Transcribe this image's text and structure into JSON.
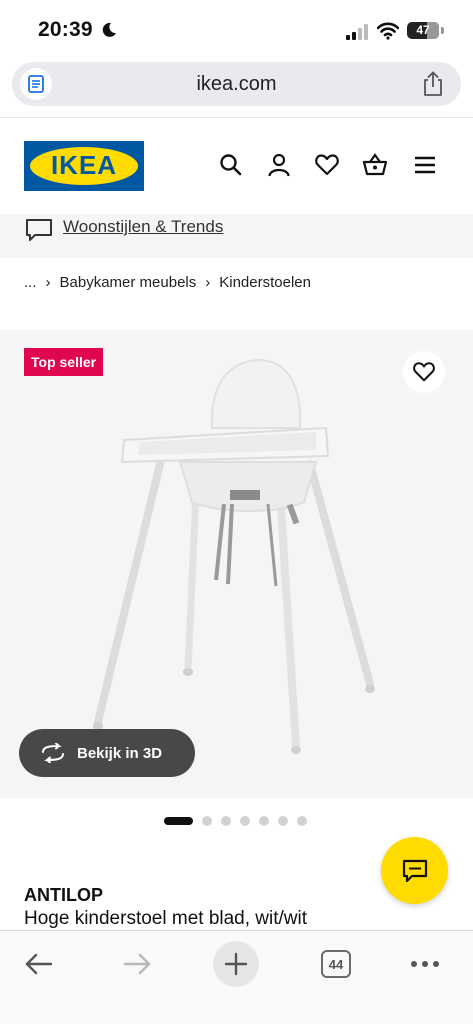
{
  "status_bar": {
    "time": "20:39",
    "battery_level": "47",
    "icons": [
      "moon-icon",
      "cellular-signal-icon",
      "wifi-icon",
      "battery-icon"
    ]
  },
  "browser": {
    "url": "ikea.com",
    "tabs_count": "44",
    "icons": [
      "reader-icon",
      "share-icon",
      "back-arrow-icon",
      "forward-arrow-icon",
      "new-tab-plus-icon",
      "tabs-icon",
      "more-icon"
    ]
  },
  "header": {
    "logo_text": "IKEA",
    "colors": {
      "brand_blue": "#0058a3",
      "brand_yellow": "#ffdb00"
    },
    "icons": [
      "search-icon",
      "account-icon",
      "heart-icon",
      "basket-icon",
      "menu-icon"
    ]
  },
  "inspiration": {
    "label": "Woonstijlen & Trends",
    "icon": "speech-bubble-icon"
  },
  "breadcrumb": {
    "items": [
      "...",
      "Babykamer meubels",
      "Kinderstoelen"
    ],
    "separator": "›"
  },
  "product": {
    "badge": "Top seller",
    "badge_color": "#e00751",
    "view_3d_label": "Bekijk in 3D",
    "gallery_total_images": 7,
    "gallery_active_index": 0,
    "name": "ANTILOP",
    "description": "Hoge kinderstoel met blad, wit/wit"
  },
  "chat": {
    "icon": "chat-icon",
    "color": "#ffdb00"
  }
}
